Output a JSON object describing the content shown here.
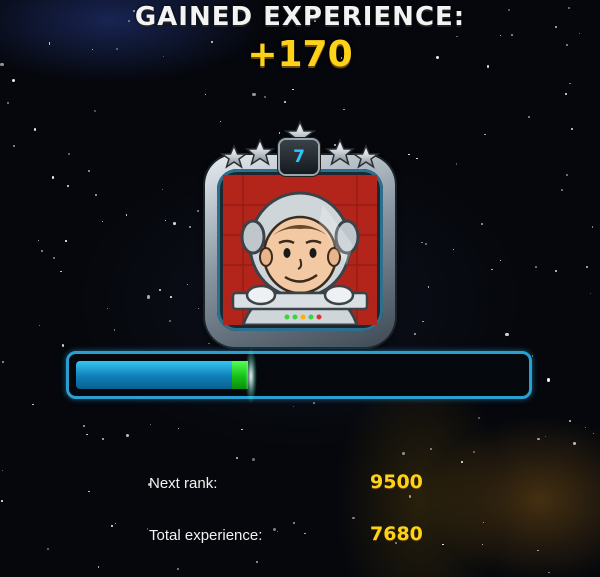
{
  "header": {
    "title": "GAINED EXPERIENCE:",
    "gained_amount": "+170"
  },
  "rank": {
    "level": "7",
    "stars_icon": "star-icon",
    "avatar_icon": "astronaut-icon"
  },
  "progress": {
    "previous_fraction": 0.35,
    "gained_fraction": 0.035
  },
  "stats": {
    "next_rank_label": "Next rank:",
    "next_rank_value": "9500",
    "total_label": "Total experience:",
    "total_value": "7680"
  },
  "colors": {
    "accent_yellow": "#ffd21a",
    "bar_blue": "#1ea4dc",
    "bar_green": "#22e022",
    "rank_text": "#2ec6ff"
  }
}
